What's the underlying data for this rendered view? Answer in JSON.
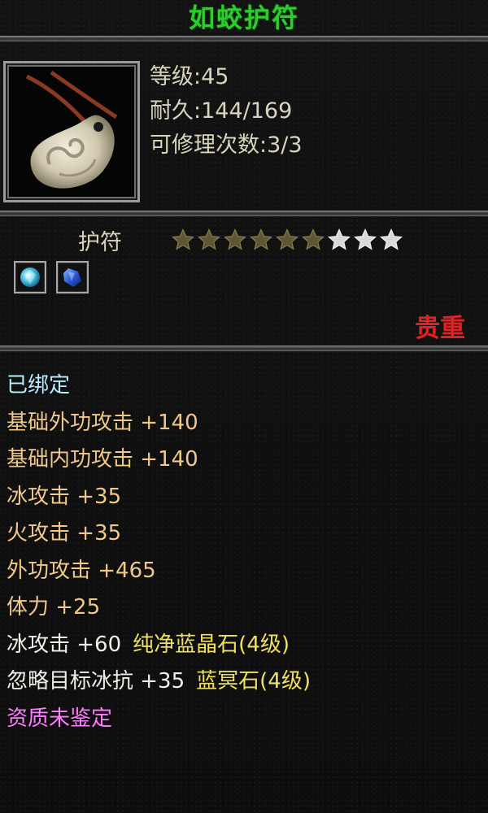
{
  "item": {
    "name": "如蛟护符",
    "level_label": "等级:45",
    "durability_label": "耐久:144/169",
    "repair_label": "可修理次数:3/3",
    "type": "护符",
    "rarity": "贵重",
    "stars_total": 9,
    "stars_filled": 6,
    "icon": "jade-amulet-icon",
    "gems": [
      "blue-crystal-gem-icon",
      "blue-sapphire-gem-icon"
    ]
  },
  "colors": {
    "title": "#2ecc2e",
    "rarity": "#e22222",
    "bound": "#b8ecff",
    "base_attr": "#f0c88a",
    "gem_attr": "#f0f0e8",
    "gem_name": "#f0e060",
    "quality": "#ff7cff"
  },
  "attributes": {
    "bound": "已绑定",
    "base_outer_attack": "基础外功攻击 +140",
    "base_inner_attack": "基础内功攻击 +140",
    "ice_attack": "冰攻击 +35",
    "fire_attack": "火攻击 +35",
    "outer_attack": "外功攻击 +465",
    "stamina": "体力 +25",
    "gem1_attr": "冰攻击 +60",
    "gem1_name": "纯净蓝晶石(4级)",
    "gem2_attr": "忽略目标冰抗 +35",
    "gem2_name": "蓝冥石(4级)",
    "quality": "资质未鉴定"
  }
}
